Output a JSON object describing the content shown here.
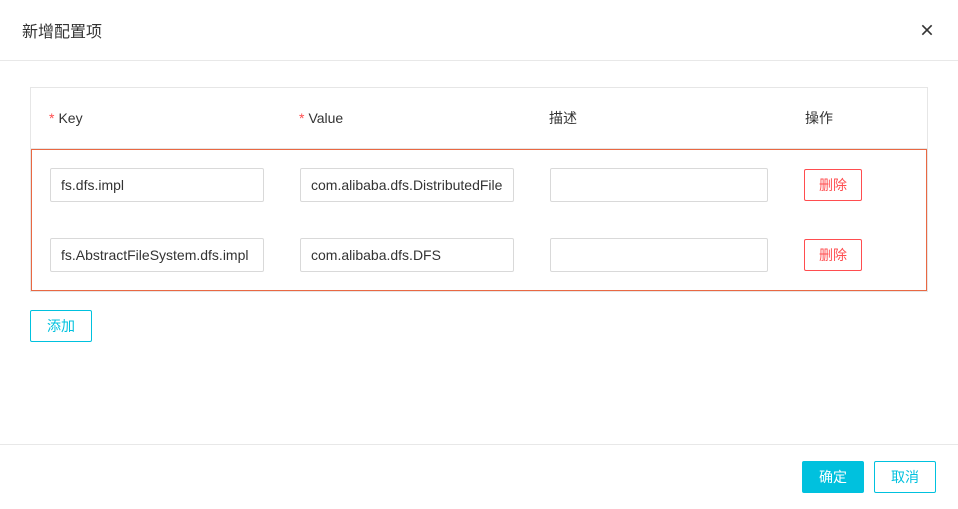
{
  "dialog": {
    "title": "新增配置项"
  },
  "table": {
    "headers": {
      "key": "Key",
      "value": "Value",
      "description": "描述",
      "action": "操作"
    },
    "rows": [
      {
        "key": "fs.dfs.impl",
        "value": "com.alibaba.dfs.DistributedFileSystem",
        "description": ""
      },
      {
        "key": "fs.AbstractFileSystem.dfs.impl",
        "value": "com.alibaba.dfs.DFS",
        "description": ""
      }
    ]
  },
  "buttons": {
    "delete": "删除",
    "add": "添加",
    "confirm": "确定",
    "cancel": "取消"
  },
  "colors": {
    "accent": "#00c1de",
    "danger": "#ff4d4f",
    "highlight_border": "#e96843"
  }
}
